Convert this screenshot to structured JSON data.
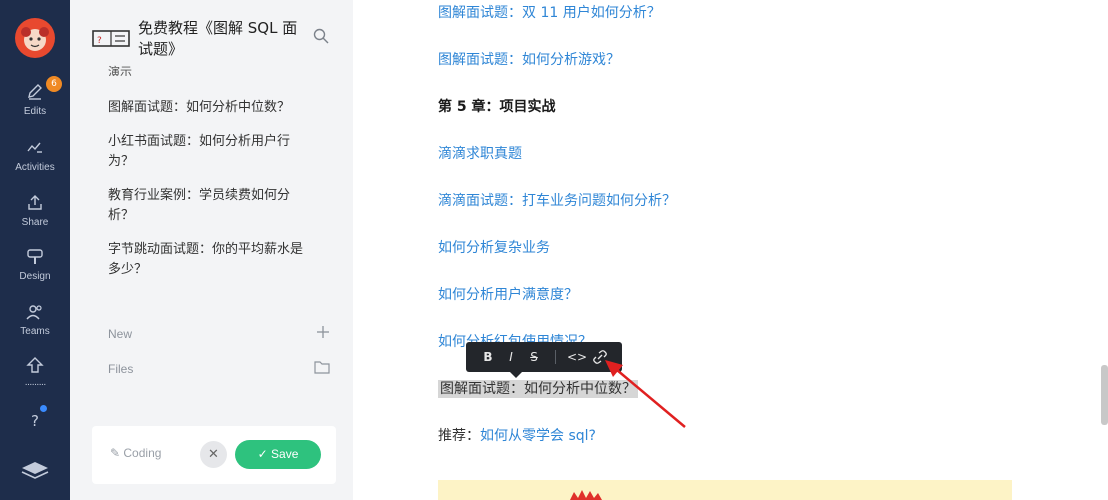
{
  "rail": {
    "items": [
      {
        "label": "Edits",
        "icon": "edit-icon"
      },
      {
        "label": "Activities",
        "icon": "activity-icon"
      },
      {
        "label": "Share",
        "icon": "share-icon"
      },
      {
        "label": "Design",
        "icon": "design-icon"
      },
      {
        "label": "Teams",
        "icon": "teams-icon"
      },
      {
        "label": "",
        "icon": "export-icon"
      },
      {
        "label": "",
        "icon": "help-icon"
      },
      {
        "label": "",
        "icon": "layers-icon"
      }
    ],
    "badge": "6"
  },
  "sidebar": {
    "title": "免费教程《图解 SQL 面试题》",
    "cut_item": "演示",
    "items": [
      "图解面试题：如何分析中位数？",
      "小红书面试题：如何分析用户行为？",
      "教育行业案例：学员续费如何分析？",
      "字节跳动面试题：你的平均薪水是多少？"
    ],
    "new_label": "New",
    "files_label": "Files"
  },
  "editor": {
    "editing_label": "Coding",
    "save_label": "Save"
  },
  "content": {
    "lines": [
      "图解面试题：双 11 用户如何分析？",
      "图解面试题：如何分析游戏？",
      "第 5 章：项目实战",
      "滴滴求职真题",
      "滴滴面试题：打车业务问题如何分析？",
      "如何分析复杂业务",
      "如何分析用户满意度？",
      "如何分析红包使用情况？",
      "图解面试题：如何分析中位数？"
    ],
    "recommend_prefix": "推荐：",
    "recommend_link": "如何从零学会 sql?"
  },
  "toolbar": {
    "bold": "B",
    "italic": "I",
    "strike": "S",
    "code": "<>",
    "link_icon": "link-icon"
  },
  "colors": {
    "rail_bg": "#1e2d4b",
    "link": "#2f86d6",
    "save_green": "#2ec27e",
    "arrow_red": "#e02020"
  }
}
